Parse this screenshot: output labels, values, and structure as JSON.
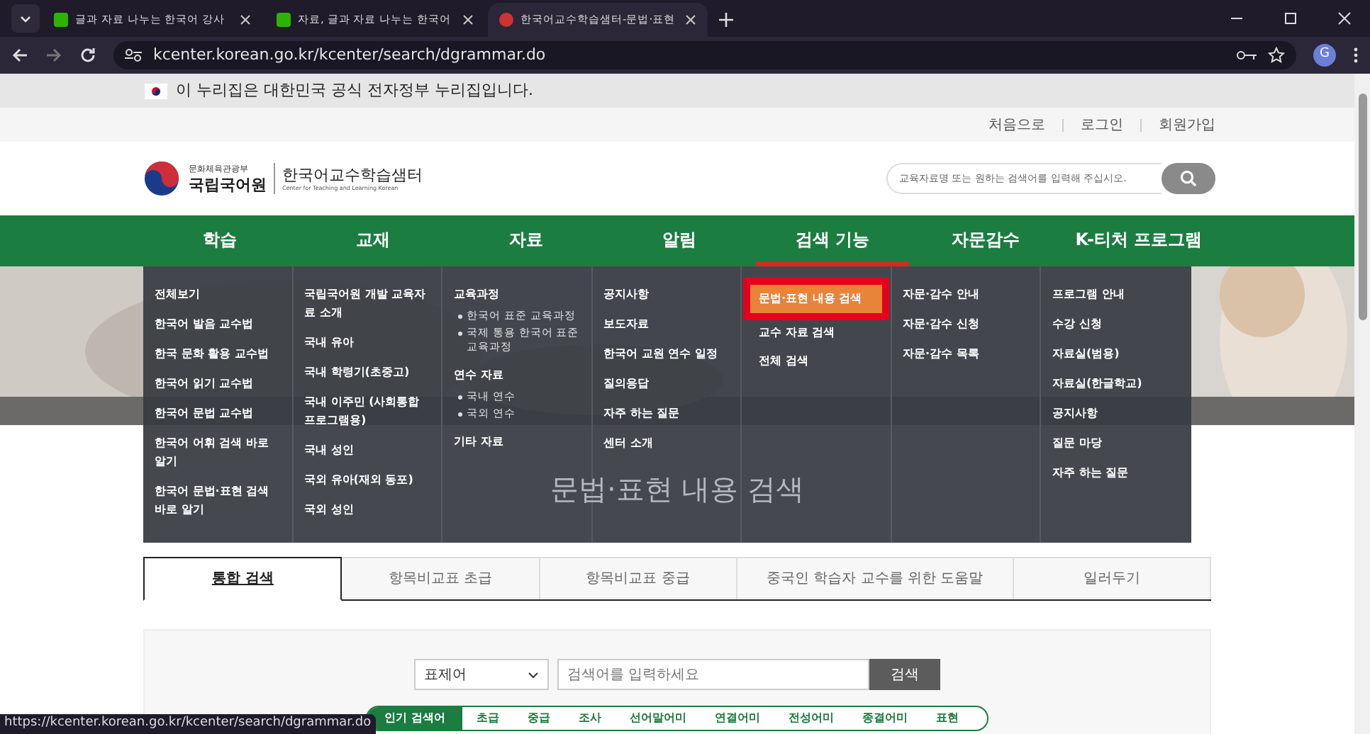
{
  "browser": {
    "tabs": [
      {
        "title": "글과 자료 나누는 한국어 강사",
        "selected": false
      },
      {
        "title": "자료, 글과 자료 나누는 한국어",
        "selected": false
      },
      {
        "title": "한국어교수학습샘터-문법·표현",
        "selected": true
      }
    ],
    "address": "kcenter.korean.go.kr/kcenter/search/dgrammar.do",
    "profile": "G"
  },
  "gov_notice": "이 누리집은 대한민국 공식 전자정부 누리집입니다.",
  "top_links": [
    "처음으로",
    "로그인",
    "회원가입"
  ],
  "header": {
    "ministry": "문화체육관광부",
    "institute": "국립국어원",
    "site": "한국어교수학습샘터",
    "site_en": "Center for Teaching and Learning Korean",
    "search": {
      "placeholder": "교육자료명 또는 원하는 검색어를 입력해 주십시오."
    }
  },
  "nav": [
    {
      "label": "학습",
      "selected": false
    },
    {
      "label": "교재",
      "selected": false
    },
    {
      "label": "자료",
      "selected": false
    },
    {
      "label": "알림",
      "selected": false
    },
    {
      "label": "검색 기능",
      "selected": true
    },
    {
      "label": "자문감수",
      "selected": false
    },
    {
      "label": "K-티처 프로그램",
      "selected": false
    }
  ],
  "mega_menu": [
    [
      {
        "label": "전체보기"
      },
      {
        "label": "한국어 발음 교수법"
      },
      {
        "label": "한국 문화 활용 교수법"
      },
      {
        "label": "한국어 읽기 교수법"
      },
      {
        "label": "한국어 문법 교수법"
      },
      {
        "label": "한국어 어휘 검색 바로 알기"
      },
      {
        "label": "한국어 문법·표현 검색 바로 알기"
      }
    ],
    [
      {
        "label": "국립국어원 개발 교육자료 소개"
      },
      {
        "label": "국내 유아"
      },
      {
        "label": "국내 학령기(초중고)"
      },
      {
        "label": "국내 이주민 (사회통합프로그램용)"
      },
      {
        "label": "국내 성인"
      },
      {
        "label": "국외 유아(재외 동포)"
      },
      {
        "label": "국외 성인"
      }
    ],
    [
      {
        "label": "교육과정",
        "children": [
          {
            "label": "한국어 표준 교육과정"
          },
          {
            "label": "국제 통용 한국어 표준 교육과정"
          }
        ]
      },
      {
        "label": "연수 자료",
        "children": [
          {
            "label": "국내 연수"
          },
          {
            "label": "국외 연수"
          }
        ]
      },
      {
        "label": "기타 자료"
      }
    ],
    [
      {
        "label": "공지사항"
      },
      {
        "label": "보도자료"
      },
      {
        "label": "한국어 교원 연수 일정"
      },
      {
        "label": "질의응답"
      },
      {
        "label": "자주 하는 질문"
      },
      {
        "label": "센터 소개"
      }
    ],
    [
      {
        "label": "문법·표현 내용 검색",
        "selected": true
      },
      {
        "label": "교수 자료 검색",
        "selected": false
      },
      {
        "label": "전체 검색",
        "selected": false
      }
    ],
    [
      {
        "label": "자문·감수 안내"
      },
      {
        "label": "자문·감수 신청"
      },
      {
        "label": "자문·감수 목록"
      }
    ],
    [
      {
        "label": "프로그램 안내"
      },
      {
        "label": "수강 신청"
      },
      {
        "label": "자료실(범용)"
      },
      {
        "label": "자료실(한글학교)"
      },
      {
        "label": "공지사항"
      },
      {
        "label": "질문 마당"
      },
      {
        "label": "자주 하는 질문"
      }
    ]
  ],
  "page_title": "문법·표현 내용 검색",
  "content_tabs": [
    {
      "label": "통합 검색",
      "selected": true
    },
    {
      "label": "항목비교표 초급",
      "selected": false
    },
    {
      "label": "항목비교표 중급",
      "selected": false
    },
    {
      "label": "중국인 학습자 교수를 위한 도움말",
      "selected": false
    },
    {
      "label": "일러두기",
      "selected": false
    }
  ],
  "search": {
    "select": "표제어",
    "placeholder": "검색어를 입력하세요",
    "button": "검색"
  },
  "popular": {
    "label": "인기 검색어",
    "terms": [
      "초급",
      "중급",
      "조사",
      "선어말어미",
      "연결어미",
      "전성어미",
      "종결어미",
      "표현"
    ]
  },
  "status_url": "https://kcenter.korean.go.kr/kcenter/search/dgrammar.do"
}
